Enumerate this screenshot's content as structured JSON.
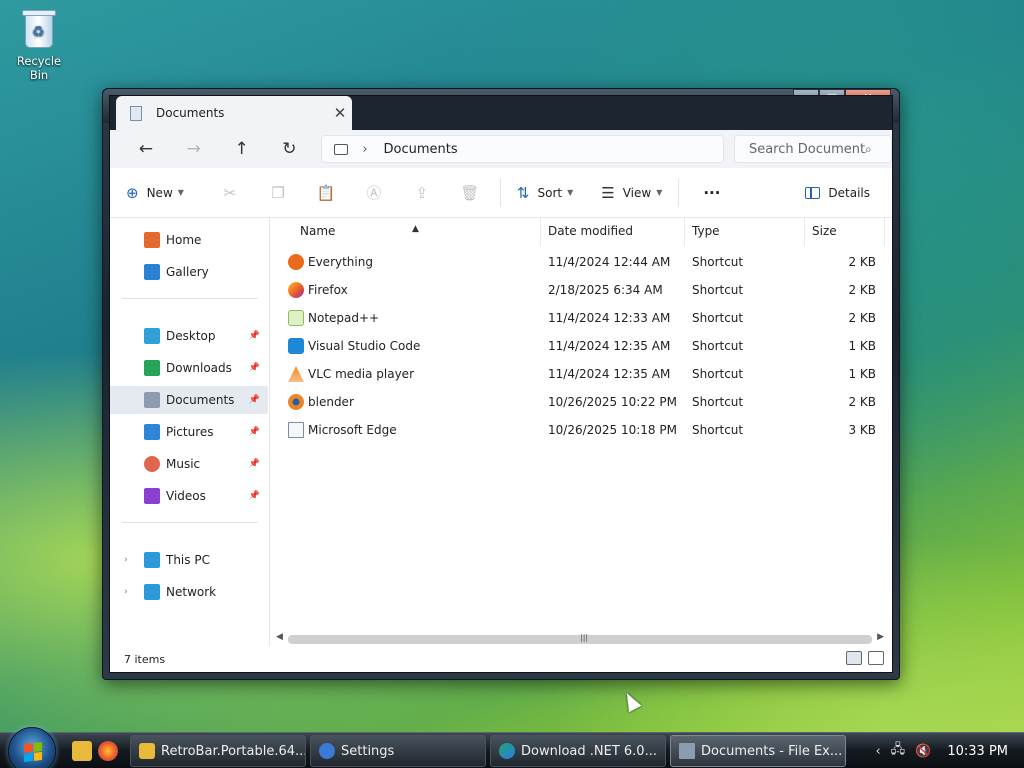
{
  "desktop": {
    "recycle_bin_label": "Recycle Bin"
  },
  "window": {
    "tab_title": "Documents",
    "nav": {
      "back": "←",
      "forward": "→",
      "up": "↑",
      "refresh": "↻"
    },
    "address": {
      "chevron": "›",
      "location": "Documents"
    },
    "search": {
      "placeholder": "Search Documents"
    },
    "commands": {
      "new": "New",
      "sort": "Sort",
      "view": "View",
      "more": "···",
      "details": "Details"
    },
    "sidebar": {
      "items": [
        {
          "label": "Home",
          "color": "#e36a2f"
        },
        {
          "label": "Gallery",
          "color": "#2b7fd4"
        },
        {
          "label": "Desktop",
          "color": "#2fa0d8"
        },
        {
          "label": "Downloads",
          "color": "#27a35a"
        },
        {
          "label": "Documents",
          "color": "#8b9bb0"
        },
        {
          "label": "Pictures",
          "color": "#2f86d6"
        },
        {
          "label": "Music",
          "color": "#e0654e"
        },
        {
          "label": "Videos",
          "color": "#8a3fd1"
        },
        {
          "label": "This PC",
          "color": "#2a9bd6"
        },
        {
          "label": "Network",
          "color": "#2a9bd6"
        }
      ]
    },
    "columns": {
      "name": "Name",
      "date": "Date modified",
      "type": "Type",
      "size": "Size"
    },
    "files": [
      {
        "name": "Everything",
        "date": "11/4/2024 12:44 AM",
        "type": "Shortcut",
        "size": "2 KB",
        "color": "#e86a1a"
      },
      {
        "name": "Firefox",
        "date": "2/18/2025 6:34 AM",
        "type": "Shortcut",
        "size": "2 KB",
        "color": "#e8552a"
      },
      {
        "name": "Notepad++",
        "date": "11/4/2024 12:33 AM",
        "type": "Shortcut",
        "size": "2 KB",
        "color": "#8cc152"
      },
      {
        "name": "Visual Studio Code",
        "date": "11/4/2024 12:35 AM",
        "type": "Shortcut",
        "size": "1 KB",
        "color": "#1e88d8"
      },
      {
        "name": "VLC media player",
        "date": "11/4/2024 12:35 AM",
        "type": "Shortcut",
        "size": "1 KB",
        "color": "#f08a1e"
      },
      {
        "name": "blender",
        "date": "10/26/2025 10:22 PM",
        "type": "Shortcut",
        "size": "2 KB",
        "color": "#e8872a"
      },
      {
        "name": "Microsoft Edge",
        "date": "10/26/2025 10:18 PM",
        "type": "Shortcut",
        "size": "3 KB",
        "color": "#d8dde4"
      }
    ],
    "status": "7 items"
  },
  "taskbar": {
    "buttons": [
      {
        "label": "RetroBar.Portable.64...",
        "color": "#e8b93a"
      },
      {
        "label": "Settings",
        "color": "#3a7bd5"
      },
      {
        "label": "Download .NET 6.0...",
        "color": "#1fa37a"
      },
      {
        "label": "Documents - File Ex...",
        "color": "#8b9bb0"
      }
    ],
    "clock": "10:33 PM"
  }
}
